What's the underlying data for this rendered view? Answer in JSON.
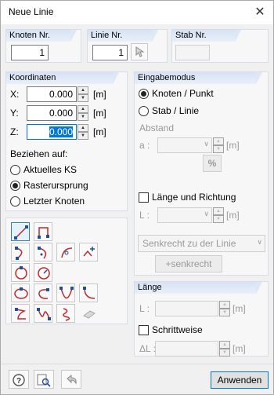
{
  "window": {
    "title": "Neue Linie",
    "close_glyph": "✕"
  },
  "knoten": {
    "label": "Knoten Nr.",
    "value": "1"
  },
  "linie": {
    "label": "Linie Nr.",
    "value": "1"
  },
  "stab": {
    "label": "Stab Nr.",
    "value": ""
  },
  "koordinaten": {
    "label": "Koordinaten",
    "rows": [
      {
        "axis": "X:",
        "value": "0.000",
        "unit": "[m]"
      },
      {
        "axis": "Y:",
        "value": "0.000",
        "unit": "[m]"
      },
      {
        "axis": "Z:",
        "value": "0.000",
        "unit": "[m]"
      }
    ],
    "beziehen_label": "Beziehen auf:",
    "options": [
      {
        "label": "Aktuelles KS",
        "selected": false
      },
      {
        "label": "Rasterursprung",
        "selected": true
      },
      {
        "label": "Letzter Knoten",
        "selected": false
      }
    ]
  },
  "eingabemodus": {
    "label": "Eingabemodus",
    "options": [
      {
        "label": "Knoten / Punkt",
        "selected": true
      },
      {
        "label": "Stab / Linie",
        "selected": false
      }
    ],
    "abstand_label": "Abstand",
    "a_label": "a :",
    "unit": "[m]",
    "percent_label": "%",
    "laenge_richtung_label": "Länge und Richtung",
    "l_label": "L :",
    "senkrecht_option": "Senkrecht zu der Linie",
    "plus_senkrecht": "+senkrecht"
  },
  "laenge": {
    "label": "Länge",
    "l_label": "L :",
    "unit": "[m]",
    "schrittweise_label": "Schrittweise",
    "delta_label": "ΔL :"
  },
  "footer": {
    "anwenden": "Anwenden"
  },
  "icons": {
    "toolbar": [
      "line-icon",
      "polyline-icon",
      "arc-icon",
      "arc-center-icon",
      "arc-tangent-icon",
      "spline-points-icon",
      "circle-icon",
      "circle-center-icon",
      "ellipse-icon",
      "elliptic-arc-icon",
      "parabola-icon",
      "curve-icon",
      "polyline-curve-icon",
      "nurbs-icon",
      "helix-icon",
      "eraser-icon"
    ],
    "footer": [
      "help-icon",
      "search-icon",
      "undo-icon"
    ]
  },
  "colors": {
    "accent": "#0078d7",
    "group_header": "#d6e3f5",
    "icon_red": "#c0282b"
  }
}
